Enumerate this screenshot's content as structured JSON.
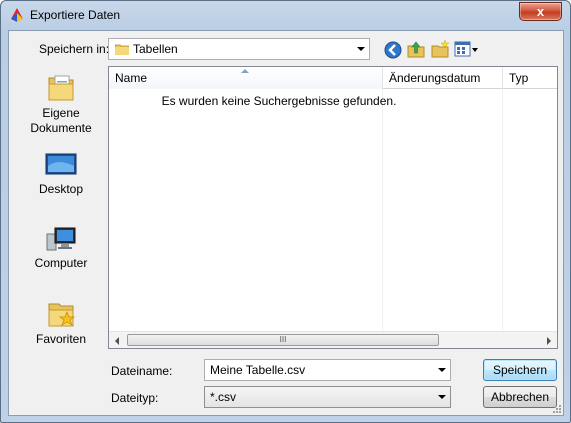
{
  "window": {
    "title": "Exportiere Daten",
    "close_glyph": "x"
  },
  "toolbar": {
    "save_in_label": "Speichern in:",
    "save_in_value": "Tabellen",
    "icons": [
      "back-icon",
      "up-folder-icon",
      "new-folder-icon",
      "view-menu-icon"
    ]
  },
  "places": [
    {
      "label": "Eigene\nDokumente",
      "line1": "Eigene",
      "line2": "Dokumente",
      "icon": "documents-icon"
    },
    {
      "label": "Desktop",
      "icon": "desktop-icon"
    },
    {
      "label": "Computer",
      "icon": "computer-icon"
    },
    {
      "label": "Favoriten",
      "icon": "favorites-icon"
    }
  ],
  "filelist": {
    "columns": [
      "Name",
      "Änderungsdatum",
      "Typ"
    ],
    "empty_message": "Es wurden keine Suchergebnisse gefunden.",
    "scroll_grip": "III"
  },
  "form": {
    "filename_label": "Dateiname:",
    "filename_value": "Meine Tabelle.csv",
    "filetype_label": "Dateityp:",
    "filetype_value": "*.csv"
  },
  "buttons": {
    "save": "Speichern",
    "cancel": "Abbrechen"
  },
  "colors": {
    "title_gradient": "#c9d8ea",
    "client_bg": "#f0f0f0",
    "close_red": "#c23c20",
    "default_button_border": "#3c7fb1"
  }
}
